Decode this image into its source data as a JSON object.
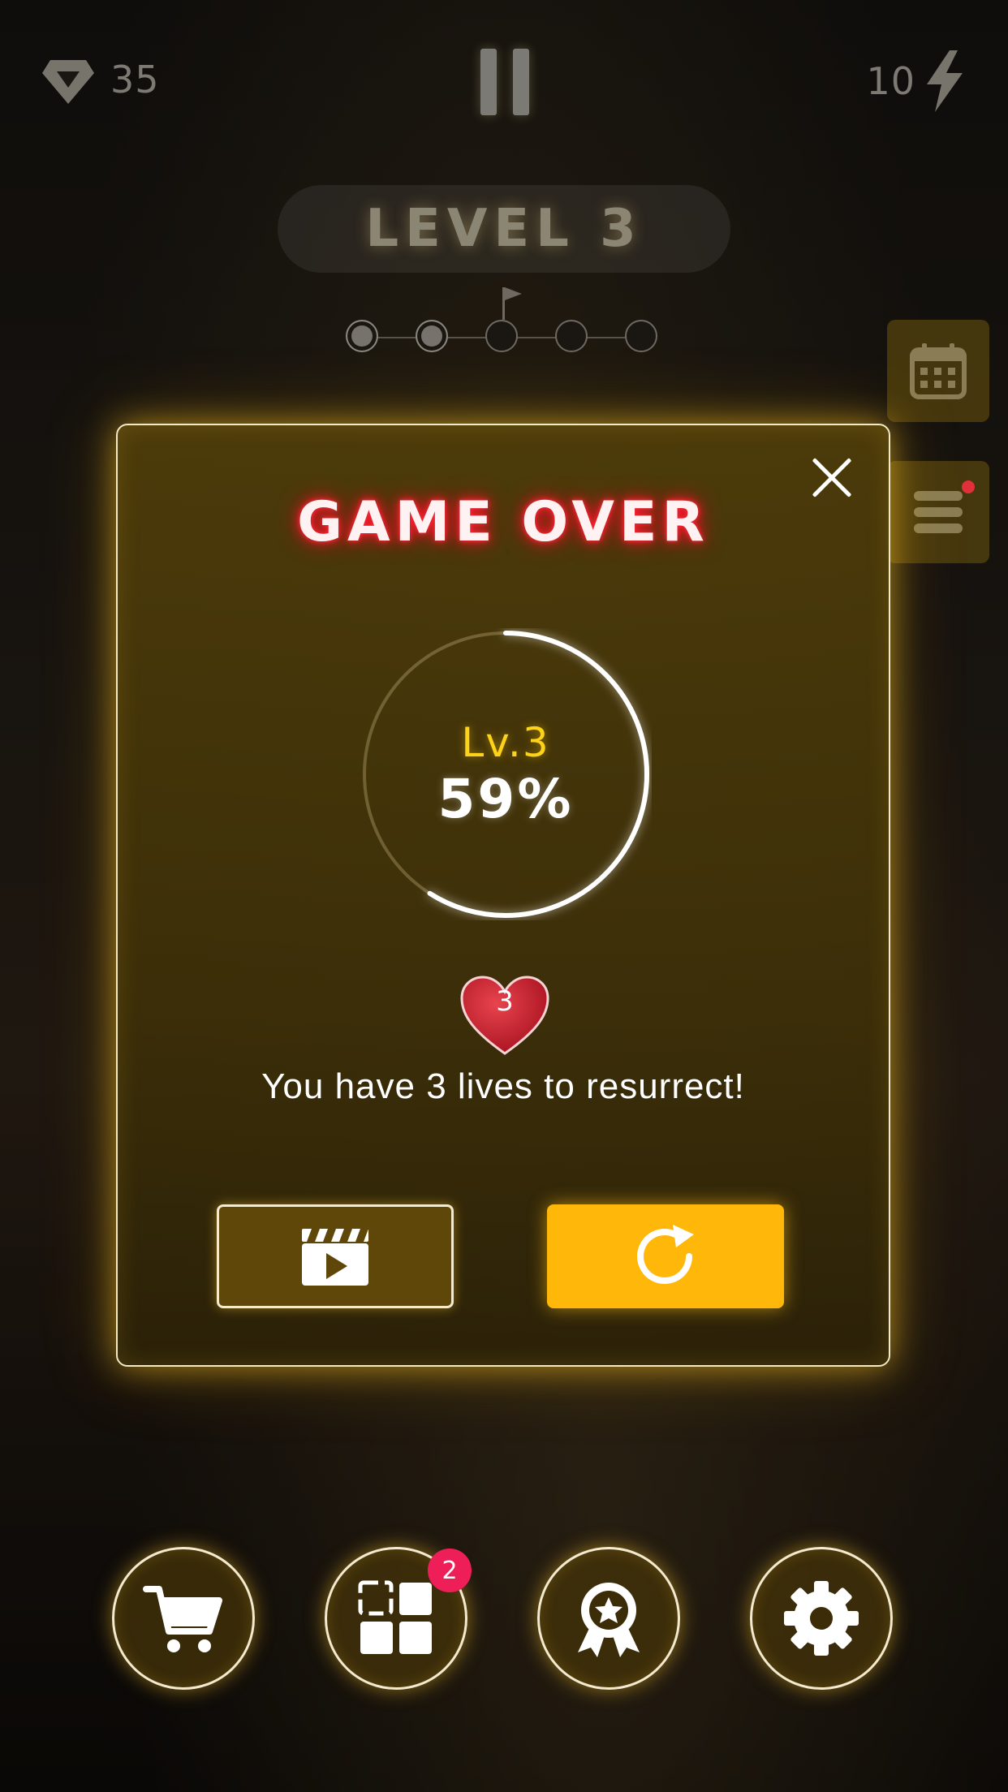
{
  "hud": {
    "gems": "35",
    "gem_icon": "diamond-icon",
    "energy": "10",
    "energy_icon": "lightning-icon",
    "pause_icon": "pause-icon"
  },
  "level": {
    "label": "LEVEL 3"
  },
  "stages": {
    "completed": 2,
    "total": 5,
    "flag_at": 3
  },
  "side": {
    "calendar_icon": "calendar-icon",
    "menu_icon": "list-icon",
    "menu_has_notification": true
  },
  "modal": {
    "title": "GAME OVER",
    "level_text": "Lv.3",
    "progress_text": "59%",
    "progress": 0.59,
    "lives": "3",
    "lives_message": "You have 3 lives to resurrect!",
    "ad_button_icon": "video-clapper-icon",
    "retry_button_icon": "retry-icon"
  },
  "nav": {
    "items": [
      {
        "name": "shop",
        "icon": "cart-icon"
      },
      {
        "name": "levels",
        "icon": "grid-icon",
        "badge": "2"
      },
      {
        "name": "achievements",
        "icon": "award-icon"
      },
      {
        "name": "settings",
        "icon": "gear-icon"
      }
    ]
  },
  "colors": {
    "accent": "#ffb70a",
    "title_glow": "#ff1a2e",
    "level_yellow": "#ffd21a",
    "badge": "#ee1f58"
  }
}
